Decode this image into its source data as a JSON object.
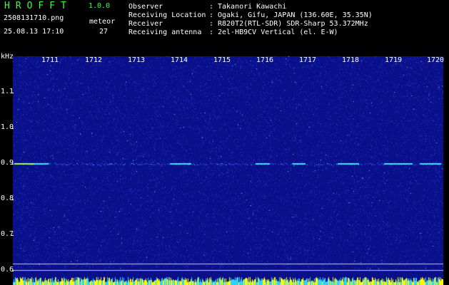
{
  "header": {
    "app_title": "HROFFT",
    "app_version": "1.0.0",
    "file_name": "2508131710.png",
    "meteor_label": "meteor",
    "datetime": "25.08.13 17:10",
    "meteor_count": "27",
    "info": [
      {
        "key": "Observer",
        "sep": ":",
        "value": "Takanori Kawachi"
      },
      {
        "key": "Receiving Location",
        "sep": ":",
        "value": "Ogaki, Gifu, JAPAN (136.60E, 35.35N)"
      },
      {
        "key": "Receiver",
        "sep": ":",
        "value": "R820T2(RTL-SDR) SDR-Sharp 53.372MHz"
      },
      {
        "key": "Receiving antenna",
        "sep": ":",
        "value": "2el-HB9CV Vertical (el. E-W)"
      }
    ]
  },
  "spectrogram": {
    "unit_label": "kHz",
    "y_ticks": [
      "1.1",
      "1.0",
      "0.9",
      "0.8",
      "0.7",
      "0.6"
    ],
    "x_ticks": [
      "1711",
      "1712",
      "1713",
      "1714",
      "1715",
      "1716",
      "1717",
      "1718",
      "1719",
      "1720"
    ],
    "colors": {
      "background": "#0a0f8a",
      "noise": "#2a3fd0",
      "echo": "#40e0ff",
      "strong_echo": "#a0ff60",
      "footer_bar": "#ffff00"
    }
  }
}
